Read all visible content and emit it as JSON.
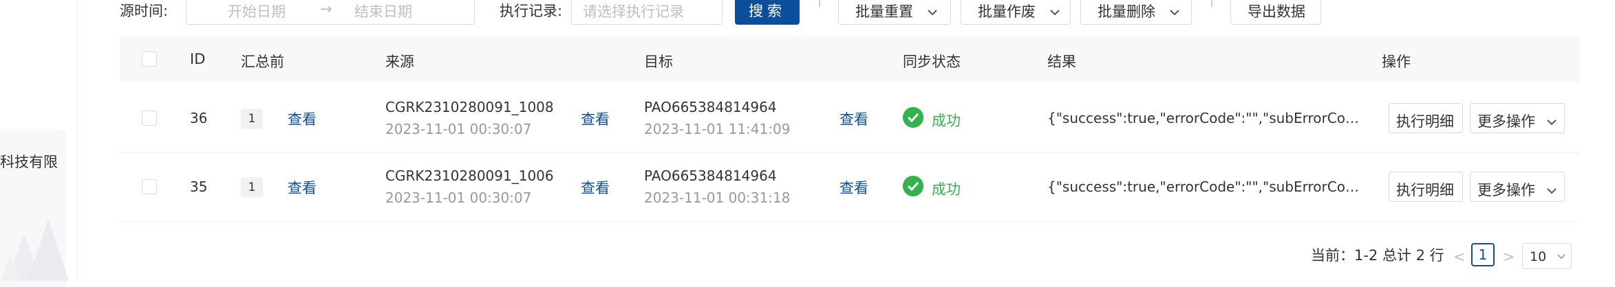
{
  "sidebar": {
    "company_name": "科技有限"
  },
  "filter": {
    "date_label": "源时间:",
    "start_placeholder": "开始日期",
    "end_placeholder": "结束日期",
    "exec_label": "执行记录:",
    "exec_placeholder": "请选择执行记录",
    "search_label": "搜索",
    "batch_reset": "批量重置",
    "batch_void": "批量作废",
    "batch_delete": "批量删除",
    "export": "导出数据"
  },
  "table": {
    "columns": [
      "ID",
      "汇总前",
      "来源",
      "目标",
      "同步状态",
      "结果",
      "操作"
    ],
    "view_label": "查看",
    "rows": [
      {
        "id": "36",
        "count": "1",
        "source_code": "CGRK2310280091_1008",
        "source_time": "2023-11-01 00:30:07",
        "target_code": "PAO665384814964",
        "target_time": "2023-11-01 11:41:09",
        "status": "成功",
        "result": "{\"success\":true,\"errorCode\":\"\",\"subErrorCode\":\"\",...",
        "detail_label": "执行明细",
        "more_label": "更多操作"
      },
      {
        "id": "35",
        "count": "1",
        "source_code": "CGRK2310280091_1006",
        "source_time": "2023-11-01 00:30:07",
        "target_code": "PAO665384814964",
        "target_time": "2023-11-01 00:31:18",
        "status": "成功",
        "result": "{\"success\":true,\"errorCode\":\"\",\"subErrorCode\":\"\",...",
        "detail_label": "执行明细",
        "more_label": "更多操作"
      }
    ]
  },
  "pagination": {
    "summary": "当前：1-2 总计 2 行",
    "prev": "<",
    "current_page": "1",
    "next": ">",
    "page_size": "10"
  },
  "colors": {
    "primary": "#0b4f9c",
    "success": "#33b34c"
  }
}
